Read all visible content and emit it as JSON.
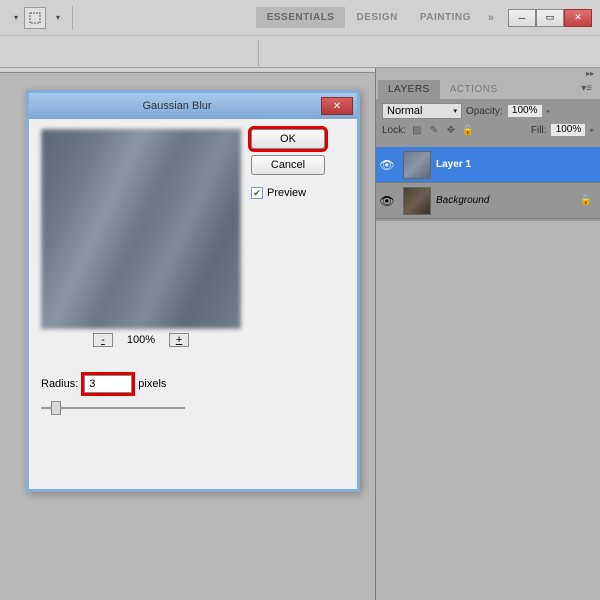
{
  "toolbar": {
    "workspaces": [
      "ESSENTIALS",
      "DESIGN",
      "PAINTING"
    ],
    "active_workspace": 0
  },
  "panels": {
    "tabs": [
      "LAYERS",
      "ACTIONS"
    ],
    "blend_mode": "Normal",
    "opacity_label": "Opacity:",
    "opacity_value": "100%",
    "lock_label": "Lock:",
    "fill_label": "Fill:",
    "fill_value": "100%",
    "layers": [
      {
        "name": "Layer 1",
        "selected": true,
        "locked": false,
        "style": "bold"
      },
      {
        "name": "Background",
        "selected": false,
        "locked": true,
        "style": "italic"
      }
    ]
  },
  "dialog": {
    "title": "Gaussian Blur",
    "ok": "OK",
    "cancel": "Cancel",
    "preview": "Preview",
    "preview_checked": true,
    "zoom": "100%",
    "minus": "-",
    "plus": "+",
    "radius_label": "Radius:",
    "radius_value": "3",
    "radius_unit": "pixels"
  }
}
